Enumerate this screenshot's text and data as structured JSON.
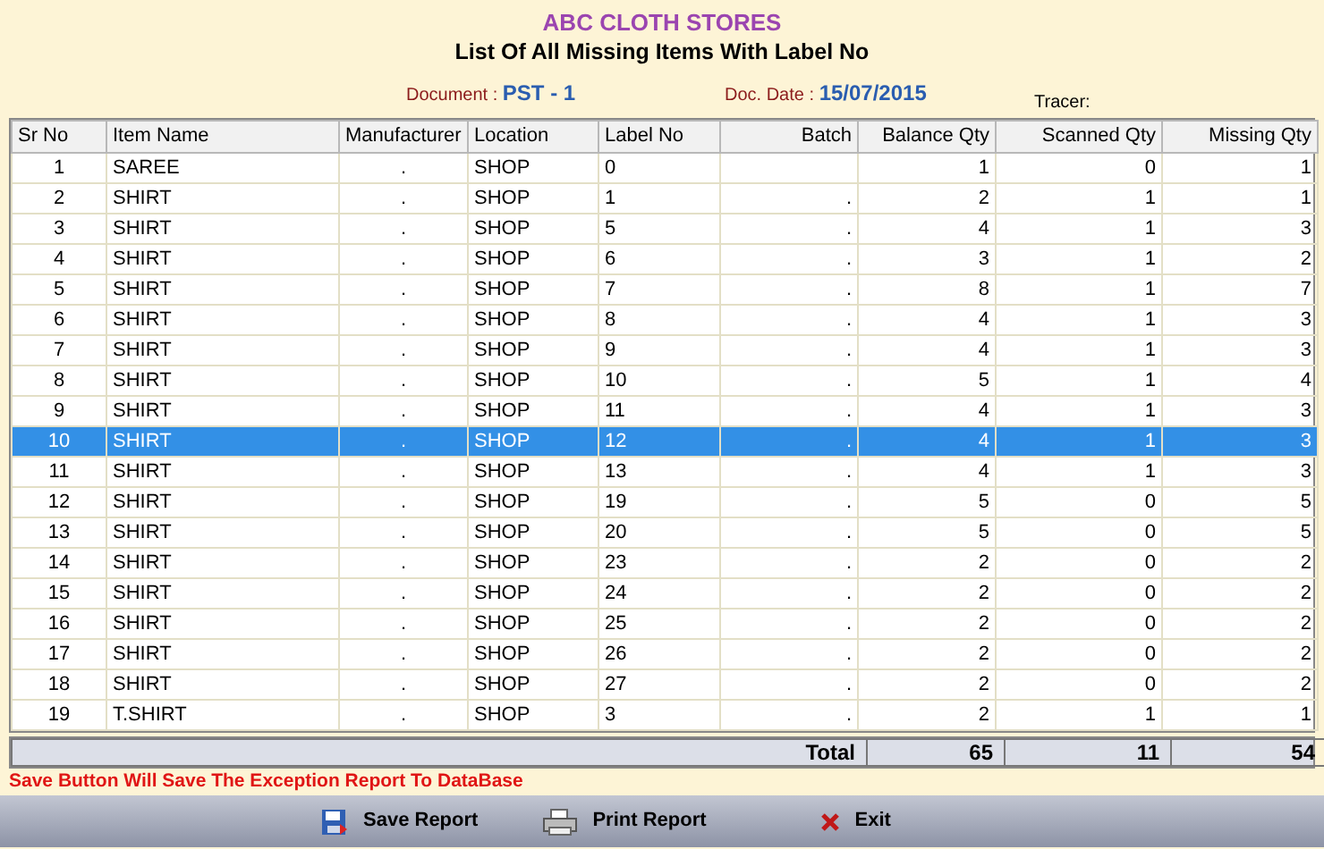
{
  "store_name": "ABC CLOTH STORES",
  "report_title": "List Of All Missing Items With Label No",
  "document": {
    "label": "Document :",
    "value": "PST - 1"
  },
  "doc_date": {
    "label": "Doc. Date :",
    "value": "15/07/2015"
  },
  "tracer": {
    "label": "Tracer:"
  },
  "table": {
    "columns": [
      "Sr No",
      "Item Name",
      "Manufacturer",
      "Location",
      "Label No",
      "Batch",
      "Balance Qty",
      "Scanned Qty",
      "Missing Qty"
    ],
    "rows": [
      {
        "cells": [
          "1",
          "SAREE",
          ".",
          "SHOP",
          "0",
          "",
          "1",
          "0",
          "1"
        ],
        "selected": false
      },
      {
        "cells": [
          "2",
          "SHIRT",
          ".",
          "SHOP",
          "1",
          ".",
          "2",
          "1",
          "1"
        ],
        "selected": false
      },
      {
        "cells": [
          "3",
          "SHIRT",
          ".",
          "SHOP",
          "5",
          ".",
          "4",
          "1",
          "3"
        ],
        "selected": false
      },
      {
        "cells": [
          "4",
          "SHIRT",
          ".",
          "SHOP",
          "6",
          ".",
          "3",
          "1",
          "2"
        ],
        "selected": false
      },
      {
        "cells": [
          "5",
          "SHIRT",
          ".",
          "SHOP",
          "7",
          ".",
          "8",
          "1",
          "7"
        ],
        "selected": false
      },
      {
        "cells": [
          "6",
          "SHIRT",
          ".",
          "SHOP",
          "8",
          ".",
          "4",
          "1",
          "3"
        ],
        "selected": false
      },
      {
        "cells": [
          "7",
          "SHIRT",
          ".",
          "SHOP",
          "9",
          ".",
          "4",
          "1",
          "3"
        ],
        "selected": false
      },
      {
        "cells": [
          "8",
          "SHIRT",
          ".",
          "SHOP",
          "10",
          ".",
          "5",
          "1",
          "4"
        ],
        "selected": false
      },
      {
        "cells": [
          "9",
          "SHIRT",
          ".",
          "SHOP",
          "11",
          ".",
          "4",
          "1",
          "3"
        ],
        "selected": false
      },
      {
        "cells": [
          "10",
          "SHIRT",
          ".",
          "SHOP",
          "12",
          ".",
          "4",
          "1",
          "3"
        ],
        "selected": true
      },
      {
        "cells": [
          "11",
          "SHIRT",
          ".",
          "SHOP",
          "13",
          ".",
          "4",
          "1",
          "3"
        ],
        "selected": false
      },
      {
        "cells": [
          "12",
          "SHIRT",
          ".",
          "SHOP",
          "19",
          ".",
          "5",
          "0",
          "5"
        ],
        "selected": false
      },
      {
        "cells": [
          "13",
          "SHIRT",
          ".",
          "SHOP",
          "20",
          ".",
          "5",
          "0",
          "5"
        ],
        "selected": false
      },
      {
        "cells": [
          "14",
          "SHIRT",
          ".",
          "SHOP",
          "23",
          ".",
          "2",
          "0",
          "2"
        ],
        "selected": false
      },
      {
        "cells": [
          "15",
          "SHIRT",
          ".",
          "SHOP",
          "24",
          ".",
          "2",
          "0",
          "2"
        ],
        "selected": false
      },
      {
        "cells": [
          "16",
          "SHIRT",
          ".",
          "SHOP",
          "25",
          ".",
          "2",
          "0",
          "2"
        ],
        "selected": false
      },
      {
        "cells": [
          "17",
          "SHIRT",
          ".",
          "SHOP",
          "26",
          ".",
          "2",
          "0",
          "2"
        ],
        "selected": false
      },
      {
        "cells": [
          "18",
          "SHIRT",
          ".",
          "SHOP",
          "27",
          ".",
          "2",
          "0",
          "2"
        ],
        "selected": false
      },
      {
        "cells": [
          "19",
          "T.SHIRT",
          ".",
          "SHOP",
          "3",
          ".",
          "2",
          "1",
          "1"
        ],
        "selected": false
      }
    ],
    "total": {
      "label": "Total",
      "values": [
        "65",
        "11",
        "54"
      ]
    }
  },
  "message": "Save Button Will Save The Exception Report To DataBase",
  "buttons": [
    {
      "kind": "save",
      "label": "Save Report"
    },
    {
      "kind": "print",
      "label": "Print Report"
    },
    {
      "kind": "exit",
      "label": "Exit"
    }
  ]
}
